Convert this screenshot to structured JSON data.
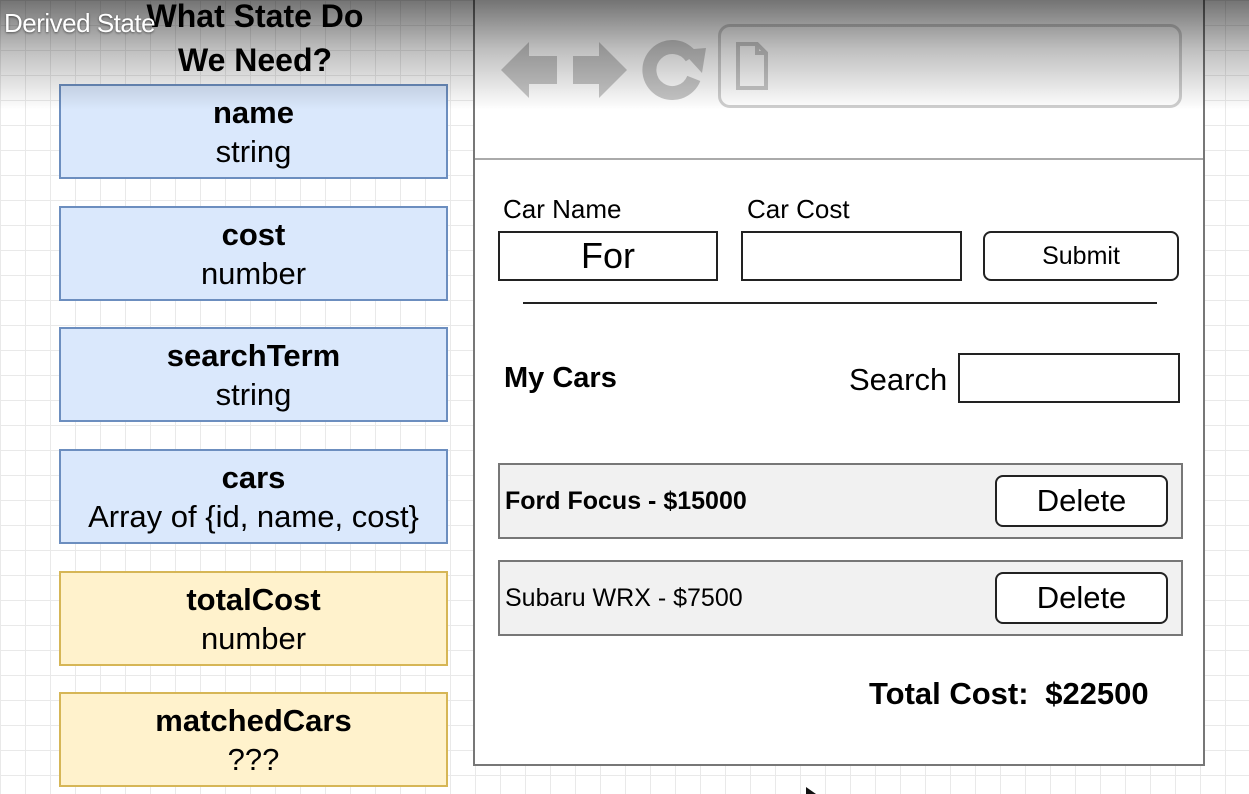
{
  "video_title": "Derived State",
  "heading": {
    "line1": "What State Do",
    "line2": "We Need?"
  },
  "state_items": [
    {
      "name": "name",
      "type": "string",
      "kind": "state"
    },
    {
      "name": "cost",
      "type": "number",
      "kind": "state"
    },
    {
      "name": "searchTerm",
      "type": "string",
      "kind": "state"
    },
    {
      "name": "cars",
      "type": "Array of {id, name, cost}",
      "kind": "state"
    },
    {
      "name": "totalCost",
      "type": "number",
      "kind": "derived"
    },
    {
      "name": "matchedCars",
      "type": "???",
      "kind": "derived"
    }
  ],
  "colors": {
    "state_fill": "#dae8fc",
    "state_border": "#6c8ebf",
    "derived_fill": "#fff2cc",
    "derived_border": "#d6b656"
  },
  "browser": {
    "icons": [
      "back-arrow-icon",
      "forward-arrow-icon",
      "refresh-icon",
      "page-icon"
    ],
    "form": {
      "car_name_label": "Car Name",
      "car_name_value": "For",
      "car_cost_label": "Car Cost",
      "car_cost_value": "",
      "submit_label": "Submit"
    },
    "list": {
      "title": "My Cars",
      "search_label": "Search",
      "search_value": "",
      "cars": [
        {
          "text": "Ford Focus - $15000",
          "delete_label": "Delete",
          "bold": true
        },
        {
          "text": "Subaru WRX - $7500",
          "delete_label": "Delete",
          "bold": false
        }
      ],
      "total_label": "Total Cost:",
      "total_value": "$22500"
    }
  }
}
